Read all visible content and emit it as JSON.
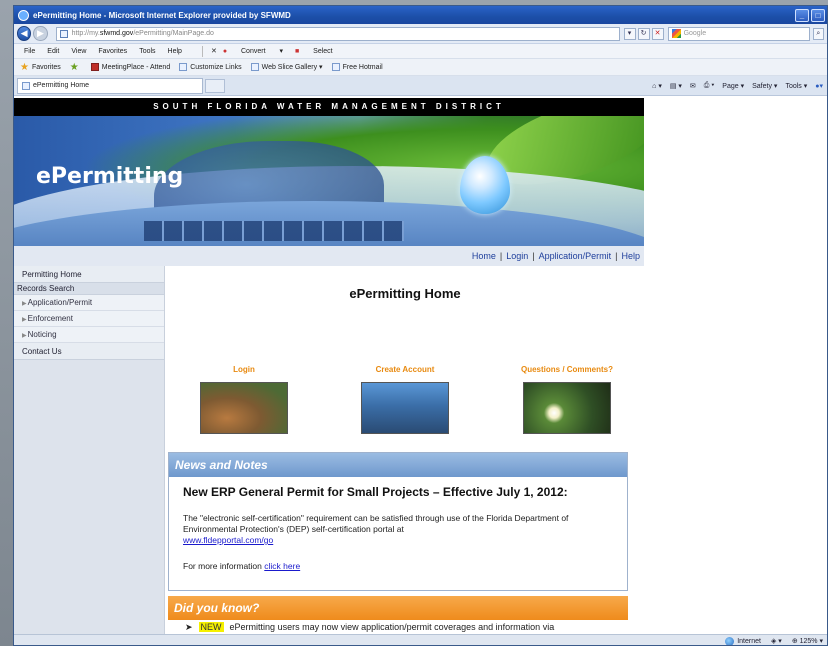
{
  "browser": {
    "title": "ePermitting Home - Microsoft Internet Explorer provided by SFWMD",
    "address_prefix": "http://my.",
    "address_host": "sfwmd.gov",
    "address_path": "/ePermitting/MainPage.do",
    "search_placeholder": "Google",
    "menu": [
      "File",
      "Edit",
      "View",
      "Favorites",
      "Tools",
      "Help"
    ],
    "convert_label": "Convert",
    "select_label": "Select",
    "favorites_label": "Favorites",
    "favorite_links": [
      "MeetingPlace - Attend",
      "Customize Links",
      "Web Slice Gallery",
      "Free Hotmail"
    ],
    "tab_title": "ePermitting Home",
    "command_bar": [
      "Page",
      "Safety",
      "Tools"
    ],
    "status_zone": "Internet",
    "zoom": "125%"
  },
  "site": {
    "district": "SOUTH FLORIDA WATER MANAGEMENT DISTRICT",
    "banner_title": "ePermitting",
    "top_links": [
      "Home",
      "Login",
      "Application/Permit",
      "Help"
    ],
    "sidenav": {
      "permitting_home": "Permitting Home",
      "records_search": "Records Search",
      "sub": [
        "Application/Permit",
        "Enforcement",
        "Noticing"
      ],
      "contact": "Contact Us"
    },
    "page_title": "ePermitting Home",
    "tiles": {
      "login": "Login",
      "create": "Create Account",
      "questions": "Questions / Comments?"
    },
    "news": {
      "header": "News and Notes",
      "headline": "New ERP General Permit for Small Projects – Effective July 1, 2012:",
      "para": "The \"electronic self-certification\" requirement can be satisfied through use of the Florida Department of Environmental Protection's (DEP) self-certification portal at",
      "portal_link": "www.fldepportal.com/go",
      "more_prefix": "For more information",
      "more_link": "click here"
    },
    "dyk": {
      "header": "Did you know?",
      "bullet": "➤",
      "new_badge": "NEW",
      "text": "ePermitting users may now view application/permit coverages and information via"
    }
  }
}
